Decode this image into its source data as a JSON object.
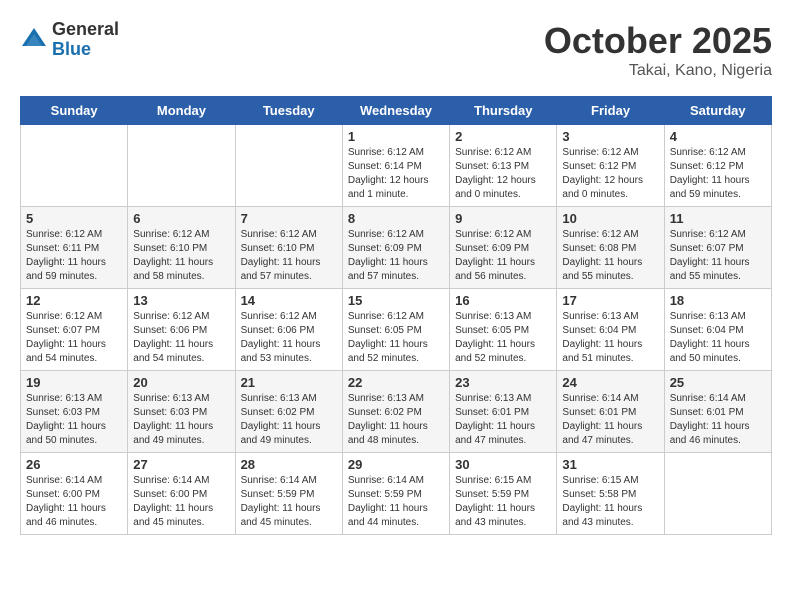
{
  "header": {
    "logo_general": "General",
    "logo_blue": "Blue",
    "month_title": "October 2025",
    "location": "Takai, Kano, Nigeria"
  },
  "weekdays": [
    "Sunday",
    "Monday",
    "Tuesday",
    "Wednesday",
    "Thursday",
    "Friday",
    "Saturday"
  ],
  "weeks": [
    [
      {
        "day": "",
        "info": ""
      },
      {
        "day": "",
        "info": ""
      },
      {
        "day": "",
        "info": ""
      },
      {
        "day": "1",
        "info": "Sunrise: 6:12 AM\nSunset: 6:14 PM\nDaylight: 12 hours\nand 1 minute."
      },
      {
        "day": "2",
        "info": "Sunrise: 6:12 AM\nSunset: 6:13 PM\nDaylight: 12 hours\nand 0 minutes."
      },
      {
        "day": "3",
        "info": "Sunrise: 6:12 AM\nSunset: 6:12 PM\nDaylight: 12 hours\nand 0 minutes."
      },
      {
        "day": "4",
        "info": "Sunrise: 6:12 AM\nSunset: 6:12 PM\nDaylight: 11 hours\nand 59 minutes."
      }
    ],
    [
      {
        "day": "5",
        "info": "Sunrise: 6:12 AM\nSunset: 6:11 PM\nDaylight: 11 hours\nand 59 minutes."
      },
      {
        "day": "6",
        "info": "Sunrise: 6:12 AM\nSunset: 6:10 PM\nDaylight: 11 hours\nand 58 minutes."
      },
      {
        "day": "7",
        "info": "Sunrise: 6:12 AM\nSunset: 6:10 PM\nDaylight: 11 hours\nand 57 minutes."
      },
      {
        "day": "8",
        "info": "Sunrise: 6:12 AM\nSunset: 6:09 PM\nDaylight: 11 hours\nand 57 minutes."
      },
      {
        "day": "9",
        "info": "Sunrise: 6:12 AM\nSunset: 6:09 PM\nDaylight: 11 hours\nand 56 minutes."
      },
      {
        "day": "10",
        "info": "Sunrise: 6:12 AM\nSunset: 6:08 PM\nDaylight: 11 hours\nand 55 minutes."
      },
      {
        "day": "11",
        "info": "Sunrise: 6:12 AM\nSunset: 6:07 PM\nDaylight: 11 hours\nand 55 minutes."
      }
    ],
    [
      {
        "day": "12",
        "info": "Sunrise: 6:12 AM\nSunset: 6:07 PM\nDaylight: 11 hours\nand 54 minutes."
      },
      {
        "day": "13",
        "info": "Sunrise: 6:12 AM\nSunset: 6:06 PM\nDaylight: 11 hours\nand 54 minutes."
      },
      {
        "day": "14",
        "info": "Sunrise: 6:12 AM\nSunset: 6:06 PM\nDaylight: 11 hours\nand 53 minutes."
      },
      {
        "day": "15",
        "info": "Sunrise: 6:12 AM\nSunset: 6:05 PM\nDaylight: 11 hours\nand 52 minutes."
      },
      {
        "day": "16",
        "info": "Sunrise: 6:13 AM\nSunset: 6:05 PM\nDaylight: 11 hours\nand 52 minutes."
      },
      {
        "day": "17",
        "info": "Sunrise: 6:13 AM\nSunset: 6:04 PM\nDaylight: 11 hours\nand 51 minutes."
      },
      {
        "day": "18",
        "info": "Sunrise: 6:13 AM\nSunset: 6:04 PM\nDaylight: 11 hours\nand 50 minutes."
      }
    ],
    [
      {
        "day": "19",
        "info": "Sunrise: 6:13 AM\nSunset: 6:03 PM\nDaylight: 11 hours\nand 50 minutes."
      },
      {
        "day": "20",
        "info": "Sunrise: 6:13 AM\nSunset: 6:03 PM\nDaylight: 11 hours\nand 49 minutes."
      },
      {
        "day": "21",
        "info": "Sunrise: 6:13 AM\nSunset: 6:02 PM\nDaylight: 11 hours\nand 49 minutes."
      },
      {
        "day": "22",
        "info": "Sunrise: 6:13 AM\nSunset: 6:02 PM\nDaylight: 11 hours\nand 48 minutes."
      },
      {
        "day": "23",
        "info": "Sunrise: 6:13 AM\nSunset: 6:01 PM\nDaylight: 11 hours\nand 47 minutes."
      },
      {
        "day": "24",
        "info": "Sunrise: 6:14 AM\nSunset: 6:01 PM\nDaylight: 11 hours\nand 47 minutes."
      },
      {
        "day": "25",
        "info": "Sunrise: 6:14 AM\nSunset: 6:01 PM\nDaylight: 11 hours\nand 46 minutes."
      }
    ],
    [
      {
        "day": "26",
        "info": "Sunrise: 6:14 AM\nSunset: 6:00 PM\nDaylight: 11 hours\nand 46 minutes."
      },
      {
        "day": "27",
        "info": "Sunrise: 6:14 AM\nSunset: 6:00 PM\nDaylight: 11 hours\nand 45 minutes."
      },
      {
        "day": "28",
        "info": "Sunrise: 6:14 AM\nSunset: 5:59 PM\nDaylight: 11 hours\nand 45 minutes."
      },
      {
        "day": "29",
        "info": "Sunrise: 6:14 AM\nSunset: 5:59 PM\nDaylight: 11 hours\nand 44 minutes."
      },
      {
        "day": "30",
        "info": "Sunrise: 6:15 AM\nSunset: 5:59 PM\nDaylight: 11 hours\nand 43 minutes."
      },
      {
        "day": "31",
        "info": "Sunrise: 6:15 AM\nSunset: 5:58 PM\nDaylight: 11 hours\nand 43 minutes."
      },
      {
        "day": "",
        "info": ""
      }
    ]
  ]
}
